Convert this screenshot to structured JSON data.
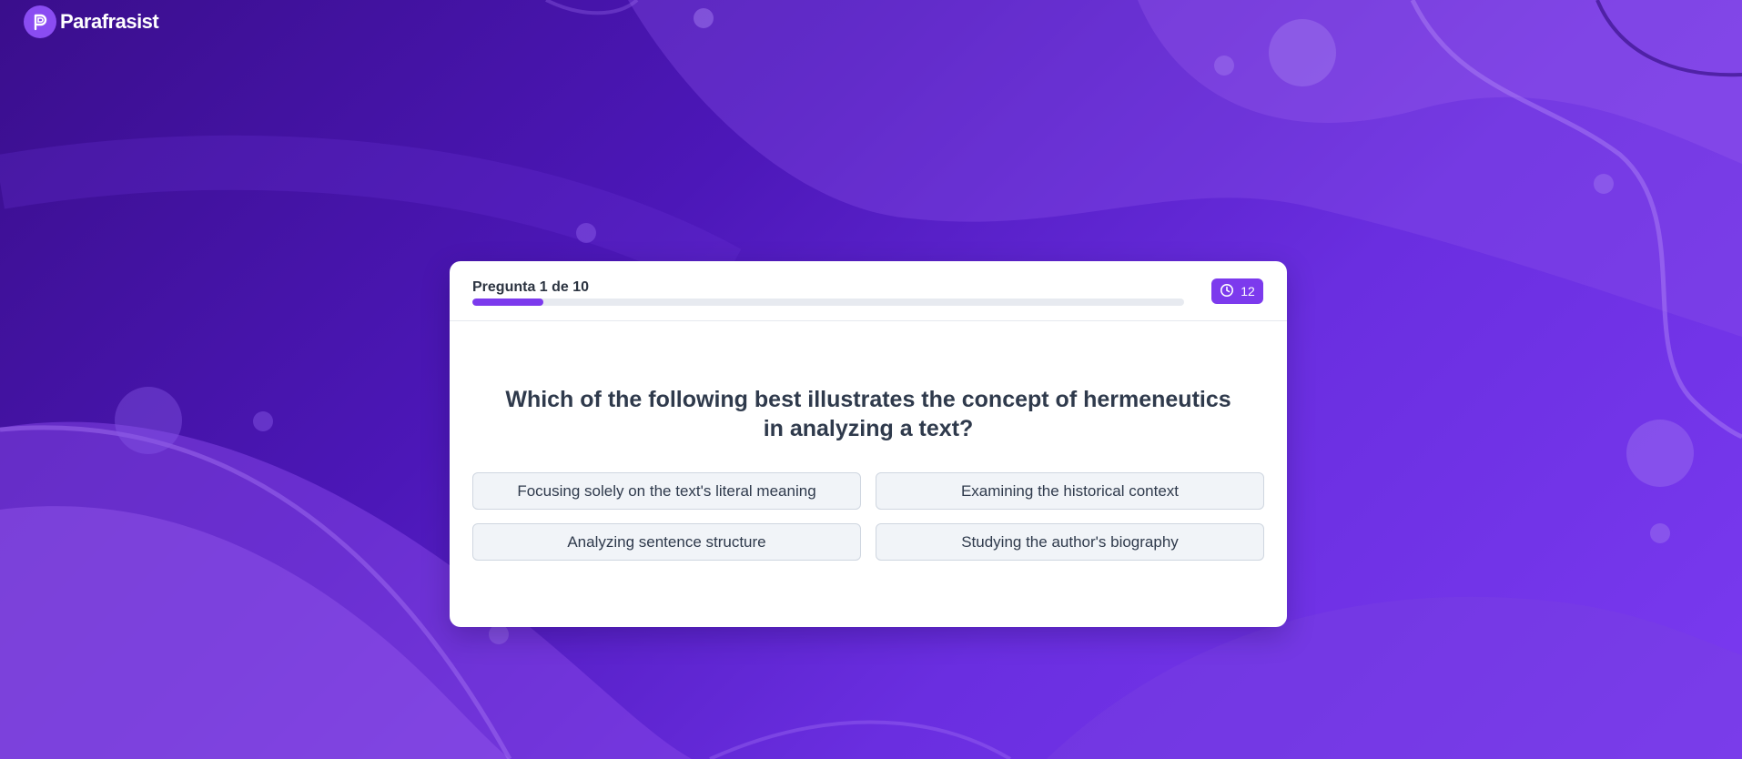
{
  "brand": {
    "name": "Parafrasist",
    "logo_icon": "parafrasist-logo-icon"
  },
  "quiz": {
    "progress_label": "Pregunta 1 de 10",
    "progress_fraction": 0.1,
    "timer": {
      "icon": "clock-icon",
      "value": "12"
    },
    "question": "Which of the following best illustrates the concept of hermeneutics in analyzing a text?",
    "answers": [
      {
        "label": "Focusing solely on the text's literal meaning"
      },
      {
        "label": "Examining the historical context"
      },
      {
        "label": "Analyzing sentence structure"
      },
      {
        "label": "Studying the author's biography"
      }
    ]
  },
  "colors": {
    "accent": "#7c3aed",
    "background_dark": "#3a0e8c",
    "background_light": "#7a3af0",
    "card": "#ffffff",
    "answer_bg": "#f1f4f8",
    "text": "#2f3a4c"
  }
}
